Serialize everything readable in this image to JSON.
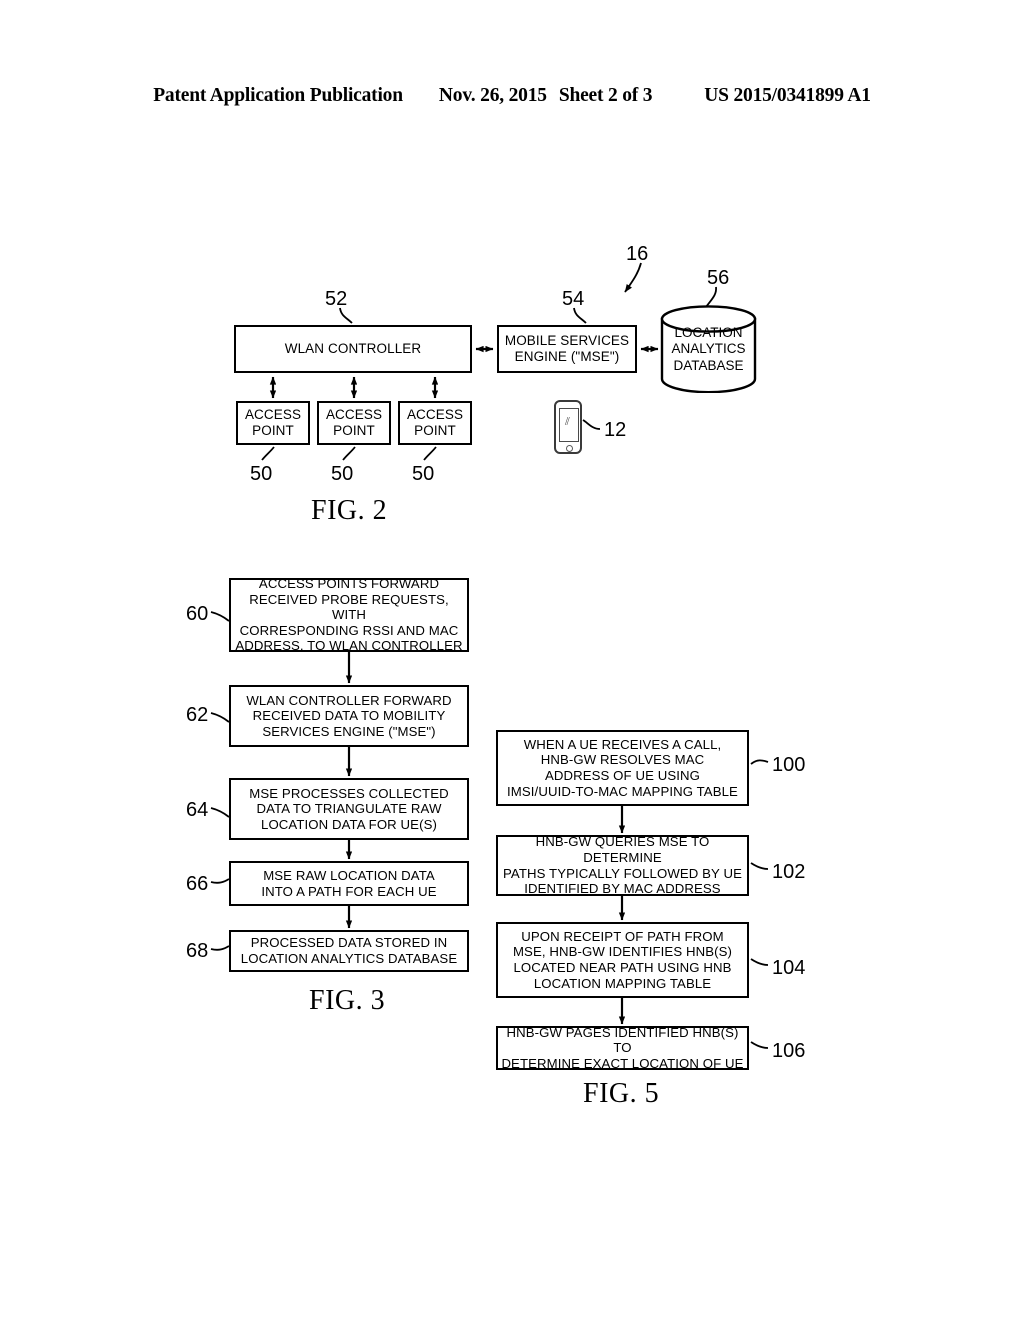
{
  "header": {
    "publication": "Patent Application Publication",
    "date": "Nov. 26, 2015",
    "sheet": "Sheet 2 of 3",
    "patent_number": "US 2015/0341899 A1"
  },
  "fig2": {
    "caption": "FIG. 2",
    "system_ref": "16",
    "wlan_controller": {
      "label": "WLAN CONTROLLER",
      "ref": "52"
    },
    "mse": {
      "line1": "MOBILE SERVICES",
      "line2": "ENGINE (\"MSE\")",
      "ref": "54"
    },
    "database": {
      "line1": "LOCATION",
      "line2": "ANALYTICS",
      "line3": "DATABASE",
      "ref": "56"
    },
    "access_points": [
      {
        "line1": "ACCESS",
        "line2": "POINT",
        "ref": "50"
      },
      {
        "line1": "ACCESS",
        "line2": "POINT",
        "ref": "50"
      },
      {
        "line1": "ACCESS",
        "line2": "POINT",
        "ref": "50"
      }
    ],
    "ue": {
      "ref": "12",
      "icon": "mobile-phone-icon"
    }
  },
  "fig3": {
    "caption": "FIG. 3",
    "steps": [
      {
        "ref": "60",
        "lines": [
          "ACCESS POINTS FORWARD",
          "RECEIVED PROBE REQUESTS, WITH",
          "CORRESPONDING RSSI AND MAC",
          "ADDRESS, TO WLAN CONTROLLER"
        ]
      },
      {
        "ref": "62",
        "lines": [
          "WLAN CONTROLLER FORWARD",
          "RECEIVED DATA TO MOBILITY",
          "SERVICES ENGINE (\"MSE\")"
        ]
      },
      {
        "ref": "64",
        "lines": [
          "MSE PROCESSES COLLECTED",
          "DATA TO TRIANGULATE RAW",
          "LOCATION DATA FOR UE(S)"
        ]
      },
      {
        "ref": "66",
        "lines": [
          "MSE RAW LOCATION DATA",
          "INTO A PATH FOR EACH UE"
        ]
      },
      {
        "ref": "68",
        "lines": [
          "PROCESSED DATA STORED IN",
          "LOCATION ANALYTICS DATABASE"
        ]
      }
    ]
  },
  "fig5": {
    "caption": "FIG. 5",
    "steps": [
      {
        "ref": "100",
        "lines": [
          "WHEN A UE RECEIVES A CALL,",
          "HNB-GW RESOLVES MAC",
          "ADDRESS OF UE USING",
          "IMSI/UUID-TO-MAC MAPPING TABLE"
        ]
      },
      {
        "ref": "102",
        "lines": [
          "HNB-GW QUERIES MSE TO DETERMINE",
          "PATHS TYPICALLY FOLLOWED BY UE",
          "IDENTIFIED BY MAC ADDRESS"
        ]
      },
      {
        "ref": "104",
        "lines": [
          "UPON RECEIPT OF PATH FROM",
          "MSE, HNB-GW IDENTIFIES HNB(S)",
          "LOCATED NEAR PATH USING HNB",
          "LOCATION MAPPING TABLE"
        ]
      },
      {
        "ref": "106",
        "lines": [
          "HNB-GW PAGES IDENTIFIED HNB(S) TO",
          "DETERMINE EXACT LOCATION OF UE"
        ]
      }
    ]
  },
  "colors": {
    "ink": "#000000",
    "paper": "#ffffff"
  }
}
